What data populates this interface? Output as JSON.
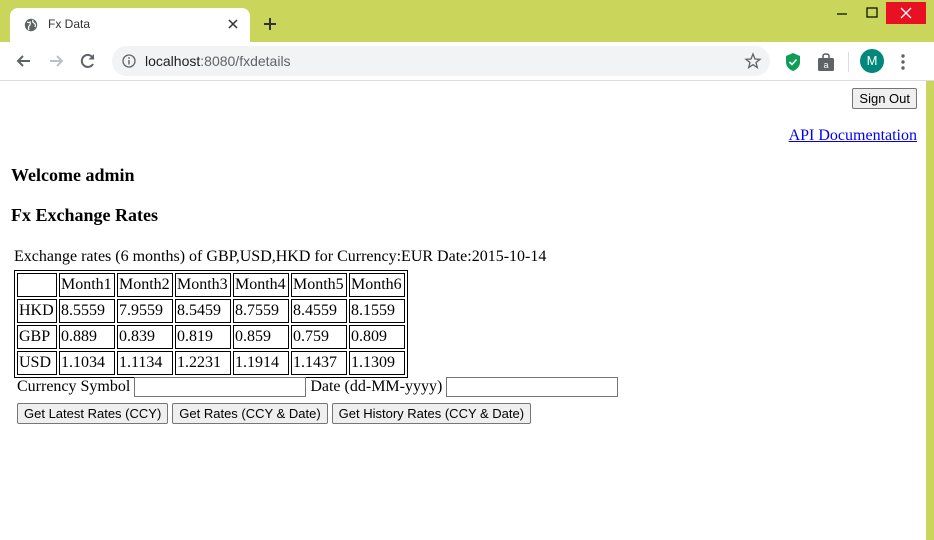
{
  "browser": {
    "tab_title": "Fx Data",
    "url_host": "localhost",
    "url_rest": ":8080/fxdetails",
    "avatar_letter": "M",
    "icons": [
      "globe-icon",
      "close-icon",
      "plus-icon",
      "back-icon",
      "forward-icon",
      "reload-icon",
      "info-icon",
      "star-icon",
      "shield-icon",
      "bag-icon",
      "menu-icon"
    ]
  },
  "page": {
    "signout_label": "Sign Out",
    "api_doc_label": "API Documentation",
    "welcome": "Welcome admin",
    "title": "Fx Exchange Rates",
    "caption": "Exchange rates (6 months) of GBP,USD,HKD for Currency:EUR Date:2015-10-14"
  },
  "table": {
    "headers": [
      "Month1",
      "Month2",
      "Month3",
      "Month4",
      "Month5",
      "Month6"
    ],
    "rows": [
      {
        "label": "HKD",
        "values": [
          "8.5559",
          "7.9559",
          "8.5459",
          "8.7559",
          "8.4559",
          "8.1559"
        ]
      },
      {
        "label": "GBP",
        "values": [
          "0.889",
          "0.839",
          "0.819",
          "0.859",
          "0.759",
          "0.809"
        ]
      },
      {
        "label": "USD",
        "values": [
          "1.1034",
          "1.1134",
          "1.2231",
          "1.1914",
          "1.1437",
          "1.1309"
        ]
      }
    ]
  },
  "form": {
    "currency_label": "Currency Symbol",
    "currency_value": "",
    "date_label": "Date (dd-MM-yyyy)",
    "date_value": "",
    "btn_latest": "Get Latest Rates (CCY)",
    "btn_rates": "Get Rates (CCY & Date)",
    "btn_history": "Get History Rates (CCY & Date)"
  },
  "colors": {
    "frame": "#c9d65b",
    "link": "#0000ee",
    "avatar": "#00897b",
    "shield": "#0f9d58"
  }
}
